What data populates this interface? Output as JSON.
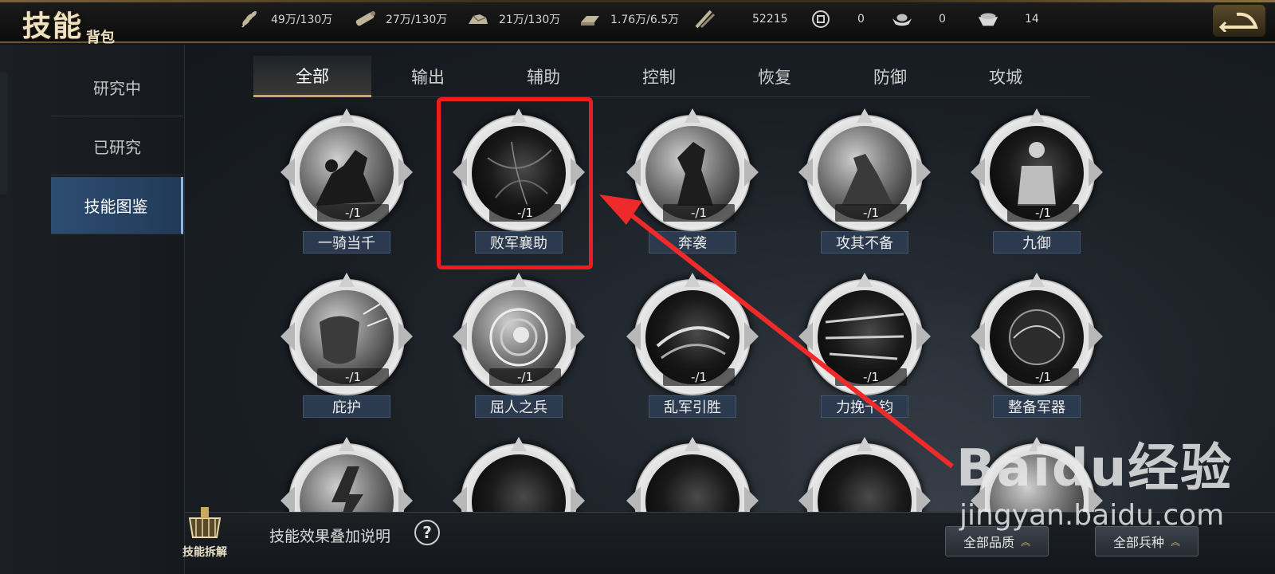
{
  "header": {
    "logo_main": "技能",
    "logo_sub": "背包",
    "resources": [
      {
        "icon": "wheat-icon",
        "value": "49万/130万"
      },
      {
        "icon": "wood-icon",
        "value": "27万/130万"
      },
      {
        "icon": "stone-icon",
        "value": "21万/130万"
      },
      {
        "icon": "iron-icon",
        "value": "1.76万/6.5万"
      },
      {
        "icon": "decree-icon",
        "value": "52215"
      },
      {
        "icon": "copper-coin-icon",
        "value": "0"
      },
      {
        "icon": "gold-ingot-icon",
        "value": "0"
      },
      {
        "icon": "silver-ingot-icon",
        "value": "14"
      }
    ]
  },
  "sidebar": {
    "items": [
      {
        "label": "研究中"
      },
      {
        "label": "已研究"
      },
      {
        "label": "技能图鉴"
      }
    ],
    "active_index": 2
  },
  "tabs": {
    "items": [
      "全部",
      "输出",
      "辅助",
      "控制",
      "恢复",
      "防御",
      "攻城"
    ],
    "active_index": 0
  },
  "skills": [
    {
      "name": "一骑当千",
      "count": "-/1"
    },
    {
      "name": "败军襄助",
      "count": "-/1"
    },
    {
      "name": "奔袭",
      "count": "-/1"
    },
    {
      "name": "攻其不备",
      "count": "-/1"
    },
    {
      "name": "九御",
      "count": "-/1"
    },
    {
      "name": "庇护",
      "count": "-/1"
    },
    {
      "name": "屈人之兵",
      "count": "-/1"
    },
    {
      "name": "乱军引胜",
      "count": "-/1"
    },
    {
      "name": "力挽千钧",
      "count": "-/1"
    },
    {
      "name": "整备军器",
      "count": "-/1"
    }
  ],
  "bottom": {
    "decompose_label": "技能拆解",
    "effect_text": "技能效果叠加说明",
    "help_glyph": "?",
    "filter_quality": "全部品质",
    "filter_troop": "全部兵种"
  },
  "watermark": {
    "brand": "Baidu经验",
    "url": "jingyan.baidu.com"
  },
  "colors": {
    "highlight": "#ee1c1c",
    "accent_gold": "#c9a862",
    "active_side": "#2d4d72"
  }
}
